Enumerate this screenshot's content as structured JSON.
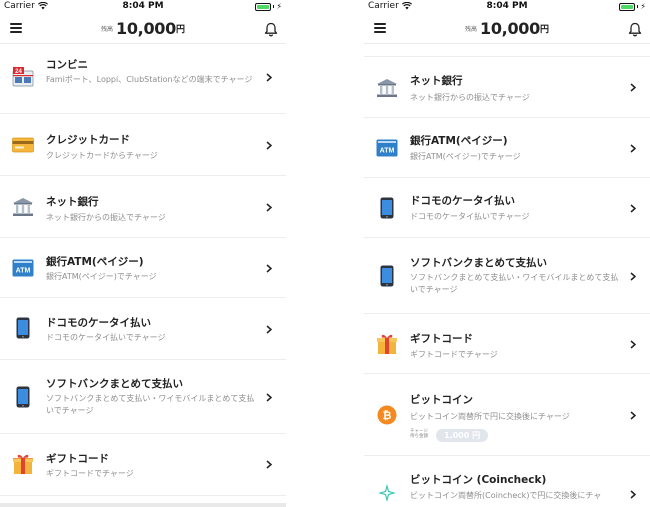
{
  "status_bar": {
    "carrier": "Carrier",
    "time": "8:04 PM"
  },
  "nav": {
    "balance_label": "残高",
    "balance_amount": "10,000",
    "balance_unit": "円"
  },
  "methods": {
    "convenience": {
      "title": "コンビニ",
      "subtitle": "Famiポート、Loppi、ClubStationなどの端末でチャージ",
      "icon": "convenience-store-icon"
    },
    "credit": {
      "title": "クレジットカード",
      "subtitle": "クレジットカードからチャージ",
      "icon": "credit-card-icon"
    },
    "netbank": {
      "title": "ネット銀行",
      "subtitle": "ネット銀行からの振込でチャージ",
      "icon": "bank-icon"
    },
    "atm": {
      "title": "銀行ATM(ペイジー)",
      "subtitle": "銀行ATM(ペイジー)でチャージ",
      "icon": "atm-icon",
      "icon_text": "ATM"
    },
    "docomo": {
      "title": "ドコモのケータイ払い",
      "subtitle": "ドコモのケータイ払いでチャージ",
      "icon": "phone-icon"
    },
    "softbank": {
      "title": "ソフトバンクまとめて支払い",
      "subtitle": "ソフトバンクまとめて支払い・ワイモバイルまとめて支払いでチャージ",
      "icon": "phone-icon"
    },
    "gift": {
      "title": "ギフトコード",
      "subtitle": "ギフトコードでチャージ",
      "icon": "gift-icon"
    },
    "bitcoin": {
      "title": "ビットコイン",
      "subtitle": "ビットコイン両替所で円に交換後にチャージ",
      "icon": "bitcoin-icon",
      "small_text": [
        "チャージ",
        "待ち金額"
      ],
      "pending_amount": "1,000 円"
    },
    "coincheck": {
      "title": "ビットコイン (Coincheck)",
      "subtitle": "ビットコイン両替所(Coincheck)で円に交換後にチャ",
      "icon": "coincheck-icon"
    }
  },
  "colors": {
    "text": "#222222",
    "subtext": "#8e8e8e",
    "divider": "#ededed",
    "atm_blue": "#2f80c9",
    "bitcoin_orange": "#f4891f",
    "coincheck_teal": "#35c6b4",
    "battery_green": "#4cd964"
  }
}
